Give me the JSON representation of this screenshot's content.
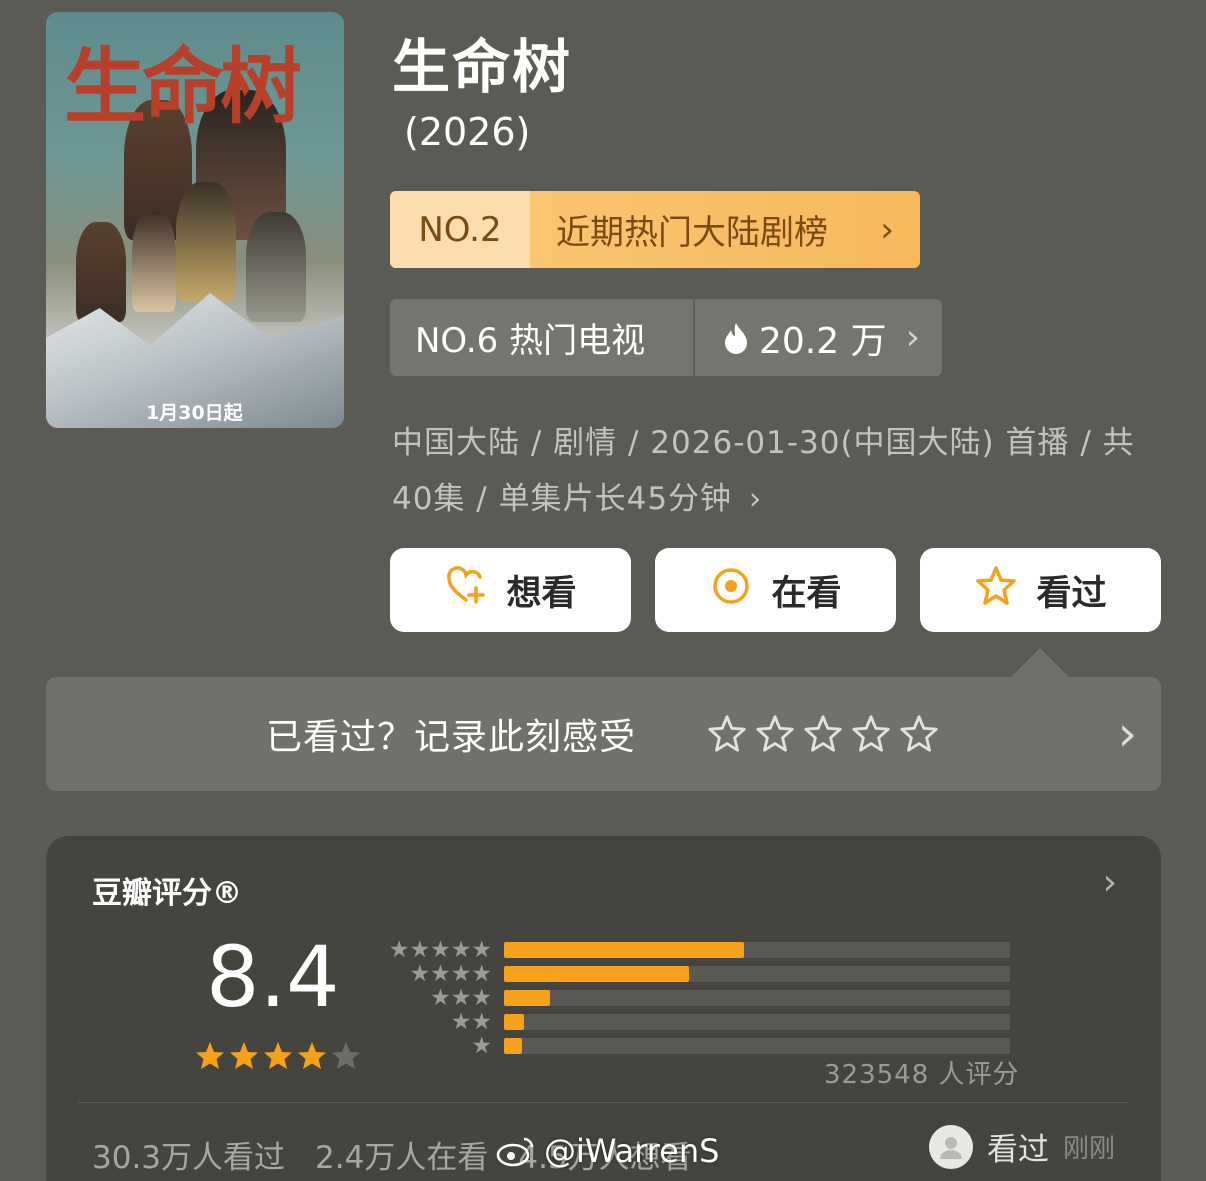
{
  "poster": {
    "title_art": "生命树",
    "date": "1月30日起"
  },
  "show": {
    "title": "生命树",
    "year": "(2026)"
  },
  "rank_primary": {
    "number": "NO.2",
    "label": "近期热门大陆剧榜",
    "chevron": "›"
  },
  "rank_secondary": {
    "label": "NO.6 热门电视",
    "heat": "20.2 万",
    "chevron": "›"
  },
  "meta": {
    "line": "中国大陆 / 剧情 / 2026-01-30(中国大陆) 首播 / 共 40集 / 单集片长45分钟",
    "chevron": "›"
  },
  "actions": {
    "want": "想看",
    "watching": "在看",
    "watched": "看过"
  },
  "record": {
    "prompt": "已看过？记录此刻感受",
    "chevron": "›"
  },
  "rating": {
    "header": "豆瓣评分®",
    "chevron": "›",
    "score": "8.4",
    "stars_filled": 4,
    "count": "323548 人评分",
    "distribution": [
      {
        "stars": 5,
        "fraction": 0.475
      },
      {
        "stars": 4,
        "fraction": 0.365
      },
      {
        "stars": 3,
        "fraction": 0.09
      },
      {
        "stars": 2,
        "fraction": 0.04
      },
      {
        "stars": 1,
        "fraction": 0.035
      }
    ]
  },
  "footer": {
    "watched_count": "30.3万人看过",
    "watching_count": "2.4万人在看",
    "want_count": "4.5万人想看",
    "user_status": "看过",
    "user_time": "刚刚"
  },
  "watermark": {
    "text": "@iWarrenS"
  },
  "colors": {
    "background": "#5b5a55",
    "accent_orange": "#f5a11b",
    "rank_gold": "#fbc978"
  }
}
